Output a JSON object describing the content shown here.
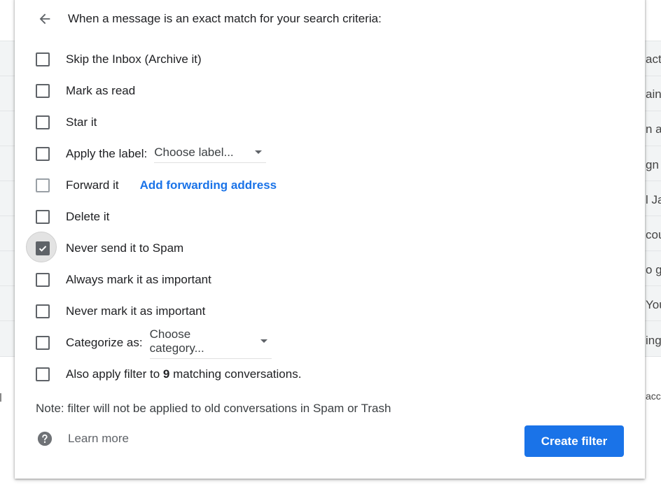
{
  "dialog": {
    "header": "When a message is an exact match for your search criteria:",
    "options": [
      {
        "label": "Skip the Inbox (Archive it)",
        "checked": false
      },
      {
        "label": "Mark as read",
        "checked": false
      },
      {
        "label": "Star it",
        "checked": false
      },
      {
        "label": "Apply the label:",
        "checked": false,
        "select_value": "Choose label..."
      },
      {
        "label": "Forward it",
        "checked": false,
        "disabled": true,
        "link": "Add forwarding address"
      },
      {
        "label": "Delete it",
        "checked": false
      },
      {
        "label": "Never send it to Spam",
        "checked": true
      },
      {
        "label": "Always mark it as important",
        "checked": false
      },
      {
        "label": "Never mark it as important",
        "checked": false
      },
      {
        "label": "Categorize as:",
        "checked": false,
        "select_value": "Choose category..."
      },
      {
        "label_prefix": "Also apply filter to ",
        "count": "9",
        "label_suffix": " matching conversations.",
        "checked": false
      }
    ],
    "note": "Note: filter will not be applied to old conversations in Spam or Trash",
    "learn_more": "Learn more",
    "create_button": "Create filter"
  },
  "background": {
    "snippets": [
      "act",
      "ain",
      "n a",
      "gn",
      "l Ja",
      "cou",
      "o g",
      "You",
      "ing",
      "acc"
    ]
  },
  "colors": {
    "accent": "#1a73e8",
    "checkbox": "#5f6368"
  }
}
